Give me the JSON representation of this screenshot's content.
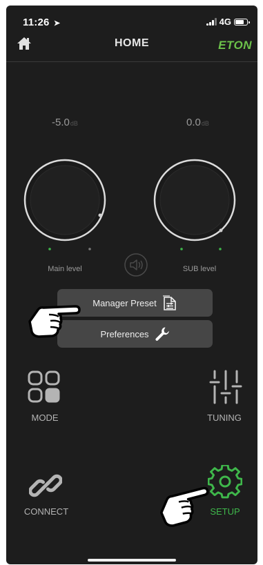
{
  "status": {
    "time": "11:26",
    "location_arrow": "➤",
    "network": "4G"
  },
  "header": {
    "title": "HOME",
    "brand": "ETON",
    "home_icon": "home-icon"
  },
  "main_level": {
    "value": "-5.0",
    "unit": "dB",
    "label": "Main level"
  },
  "sub_level": {
    "value": "0.0",
    "unit": "dB",
    "label": "SUB level"
  },
  "speaker_icon": "speaker-icon",
  "buttons": {
    "manager_preset": "Manager Preset",
    "preferences": "Preferences"
  },
  "menu": {
    "mode": "MODE",
    "tuning": "TUNING",
    "connect": "CONNECT",
    "setup": "SETUP"
  },
  "colors": {
    "accent": "#3fb84b",
    "brand": "#6cc24a",
    "background": "#1d1d1d",
    "button": "#464646"
  }
}
